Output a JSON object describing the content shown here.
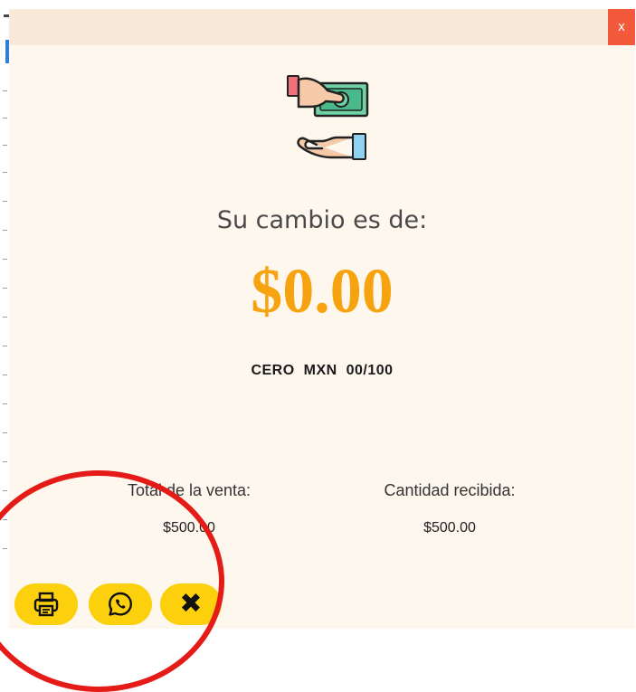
{
  "dialog": {
    "close_label": "x",
    "title": "Su cambio es de:",
    "change_amount": "$0.00",
    "change_words": "CERO  MXN  00/100"
  },
  "summary": {
    "total_label": "Total de la venta:",
    "total_value": "$500.00",
    "received_label": "Cantidad recibida:",
    "received_value": "$500.00"
  },
  "actions": [
    {
      "name": "print",
      "icon": "printer-icon"
    },
    {
      "name": "whatsapp",
      "icon": "whatsapp-icon"
    },
    {
      "name": "close",
      "icon": "close-icon",
      "glyph": "✖"
    }
  ],
  "colors": {
    "accent_amount": "#f7a30f",
    "button_yellow": "#fcd00c",
    "close_red": "#f35a3c",
    "modal_bg": "#fdf7ee",
    "header_bg": "#f8e9d8",
    "annotation_red": "#e41b17"
  }
}
